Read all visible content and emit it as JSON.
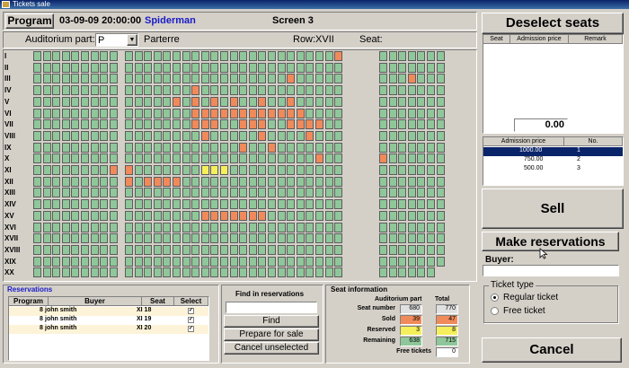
{
  "window": {
    "title": "Tickets sale"
  },
  "header": {
    "program_button": "Program",
    "datetime": "03-09-09 20:00:00",
    "movie": "Spiderman",
    "screen": "Screen 3"
  },
  "filter": {
    "auditorium_label": "Auditorium part:",
    "auditorium_value": "P",
    "part_name": "Parterre",
    "row_label": "Row:XVII",
    "seat_label": "Seat:"
  },
  "rows": [
    "I",
    "II",
    "III",
    "IV",
    "V",
    "VI",
    "VII",
    "VIII",
    "IX",
    "X",
    "XI",
    "XII",
    "XIII",
    "XIV",
    "XV",
    "XVI",
    "XVII",
    "XVIII",
    "XIX",
    "XX"
  ],
  "colors": {
    "free": "#8fc79a",
    "sold": "#f08a5a",
    "reserved": "#f4ef5a",
    "selected": "#0a246a"
  },
  "right": {
    "deselect_button": "Deselect seats",
    "seat_columns": [
      "Seat",
      "Admission price",
      "Remark"
    ],
    "total": "0.00",
    "price_columns": [
      "Admission price",
      "No."
    ],
    "prices": [
      {
        "price": "1000.00",
        "no": "1"
      },
      {
        "price": "750.00",
        "no": "2"
      },
      {
        "price": "500.00",
        "no": "3"
      }
    ],
    "sell_button": "Sell",
    "reservations_button": "Make reservations",
    "buyer_label": "Buyer:",
    "buyer_value": "",
    "ticket_type_label": "Ticket type",
    "ticket_types": [
      "Regular ticket",
      "Free ticket"
    ],
    "cancel_button": "Cancel"
  },
  "reservations": {
    "title": "Reservations",
    "columns": [
      "Program",
      "Buyer",
      "Seat",
      "Select"
    ],
    "rows": [
      {
        "program": "8",
        "buyer": "john smith",
        "seat": "XI 18"
      },
      {
        "program": "8",
        "buyer": "john smith",
        "seat": "XI 19"
      },
      {
        "program": "8",
        "buyer": "john smith",
        "seat": "XI 20"
      }
    ]
  },
  "find": {
    "title": "Find in reservations",
    "value": "",
    "find_button": "Find",
    "prepare_button": "Prepare for sale",
    "cancel_button": "Cancel unselected"
  },
  "seat_info": {
    "title": "Seat information",
    "col_auditorium": "Auditorium part",
    "col_total": "Total",
    "rows": [
      {
        "label": "Seat number",
        "part": "680",
        "total": "770"
      },
      {
        "label": "Sold",
        "part": "39",
        "total": "47"
      },
      {
        "label": "Reserved",
        "part": "3",
        "total": "8"
      },
      {
        "label": "Remaining",
        "part": "638",
        "total": "715"
      }
    ],
    "free_label": "Free tickets",
    "free_value": "0"
  }
}
